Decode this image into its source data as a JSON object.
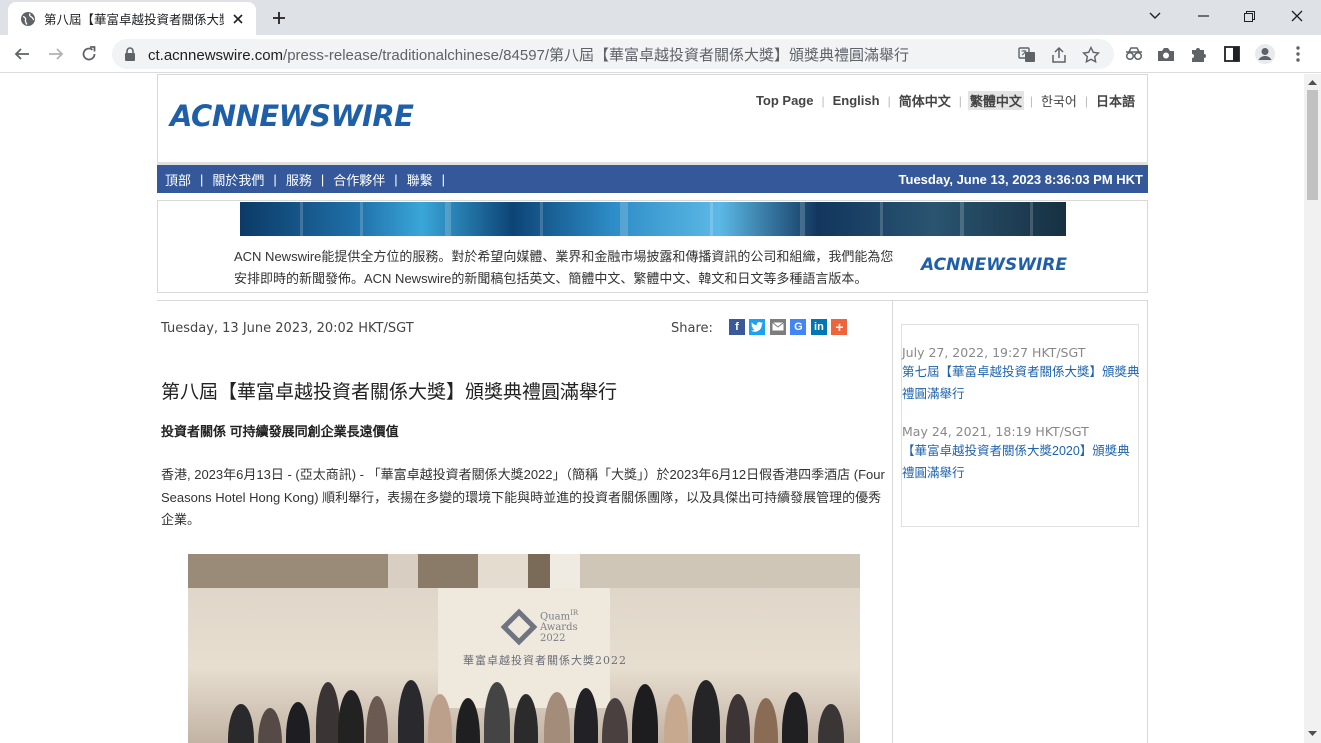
{
  "browser": {
    "tab_title": "第八屆【華富卓越投資者關係大獎",
    "url_host": "ct.acnnewswire.com",
    "url_path": "/press-release/traditionalchinese/84597/第八屆【華富卓越投資者關係大獎】頒獎典禮圓滿舉行"
  },
  "header": {
    "logo": "ACNNEWSWIRE",
    "languages": [
      {
        "label": "Top Page"
      },
      {
        "label": "English"
      },
      {
        "label": "简体中文"
      },
      {
        "label": "繁體中文"
      },
      {
        "label": "한국어"
      },
      {
        "label": "日本語"
      }
    ]
  },
  "nav": {
    "items": [
      "頂部",
      "關於我們",
      "服務",
      "合作夥伴",
      "聯繫"
    ],
    "datetime": "Tuesday, June 13, 2023 8:36:03 PM HKT"
  },
  "promo": {
    "text": "ACN Newswire能提供全方位的服務。對於希望向媒體、業界和金融市場披露和傳播資訊的公司和組織，我們能為您安排即時的新聞發佈。ACN Newswire的新聞稿包括英文、簡體中文、繁體中文、韓文和日文等多種語言版本。",
    "logo": "ACNNEWSWIRE"
  },
  "article": {
    "dateline": "Tuesday, 13 June 2023, 20:02 HKT/SGT",
    "share_label": "Share:",
    "share_icons": [
      "facebook-icon",
      "twitter-icon",
      "email-icon",
      "google-icon",
      "linkedin-icon",
      "more-share-icon"
    ],
    "headline": "第八屆【華富卓越投資者關係大獎】頒獎典禮圓滿舉行",
    "subheadline": "投資者關係 可持續發展同創企業長遠價值",
    "body": "香港, 2023年6月13日 - (亞太商訊) - 「華富卓越投資者關係大獎2022」（簡稱「大獎」）於2023年6月12日假香港四季酒店 (Four Seasons Hotel Hong Kong) 順利舉行，表揚在多變的環境下能與時並進的投資者關係團隊，以及具傑出可持續發展管理的優秀企業。",
    "photo_text": {
      "emblem_line1": "Quam",
      "emblem_line1_sup": "IR",
      "emblem_line2": "Awards",
      "emblem_line3": "2022",
      "caption": "華富卓越投資者關係大獎2022"
    }
  },
  "sidebar": {
    "related": [
      {
        "date": "July 27, 2022, 19:27 HKT/SGT",
        "title": "第七屆【華富卓越投資者關係大獎】頒獎典禮圓滿舉行"
      },
      {
        "date": "May 24, 2021, 18:19 HKT/SGT",
        "title": "【華富卓越投資者關係大獎2020】頒獎典禮圓滿舉行"
      }
    ]
  }
}
